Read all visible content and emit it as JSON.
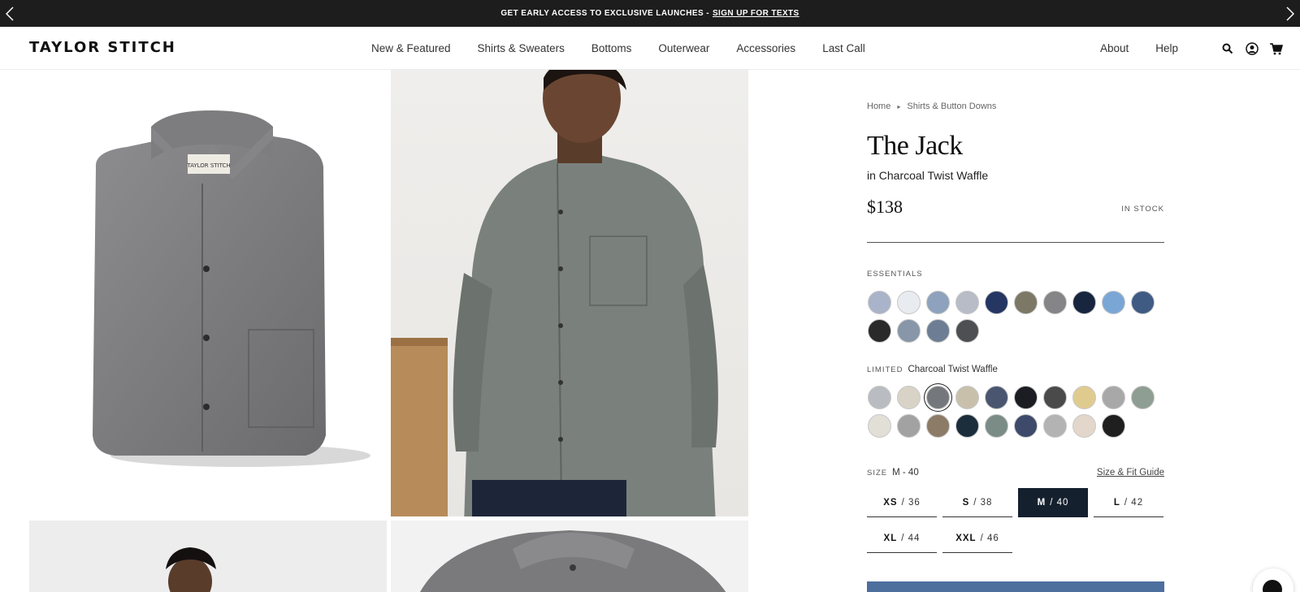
{
  "announcement": {
    "text": "GET EARLY ACCESS TO EXCLUSIVE LAUNCHES -",
    "link": "SIGN UP FOR TEXTS"
  },
  "header": {
    "logo": "TAYLOR STITCH",
    "nav": [
      "New & Featured",
      "Shirts & Sweaters",
      "Bottoms",
      "Outerwear",
      "Accessories",
      "Last Call"
    ],
    "util": [
      "About",
      "Help"
    ],
    "icons": [
      "search-icon",
      "account-icon",
      "cart-icon"
    ]
  },
  "product": {
    "breadcrumb": [
      "Home",
      "Shirts & Button Downs"
    ],
    "title": "The Jack",
    "subtitle": "in Charcoal Twist Waffle",
    "price": "$138",
    "stock": "IN STOCK",
    "essentials": {
      "label": "ESSENTIALS",
      "colors": [
        "#a9b3c9",
        "#e8ebef",
        "#8ea2bd",
        "#b7bcc6",
        "#253663",
        "#7d7866",
        "#858487",
        "#18253f",
        "#7aa6d6",
        "#3f5b83",
        "#2a2a2a",
        "#8796a8",
        "#6d7e94",
        "#4d4f52"
      ]
    },
    "limited": {
      "label": "LIMITED",
      "selected_name": "Charcoal Twist Waffle",
      "selected_index": 2,
      "colors": [
        "#b9bcc0",
        "#d9d3c7",
        "#74777b",
        "#c9c0ac",
        "#4a5670",
        "#1c1d22",
        "#4a4a4a",
        "#e0cb8f",
        "#a8a8a8",
        "#8e9e92",
        "#e2dfd6",
        "#a2a2a2",
        "#8c7b66",
        "#1c2d3c",
        "#7b8c86",
        "#3e4a6a",
        "#b3b3b3",
        "#e3d6cb",
        "#1f1f1f"
      ]
    },
    "size": {
      "label": "SIZE",
      "selected": "M - 40",
      "guide": "Size & Fit Guide",
      "options": [
        {
          "letter": "XS",
          "num": "/ 36",
          "selected": false
        },
        {
          "letter": "S",
          "num": "/ 38",
          "selected": false
        },
        {
          "letter": "M",
          "num": "/ 40",
          "selected": true
        },
        {
          "letter": "L",
          "num": "/ 42",
          "selected": false
        },
        {
          "letter": "XL",
          "num": "/ 44",
          "selected": false
        },
        {
          "letter": "XXL",
          "num": "/ 46",
          "selected": false
        }
      ]
    },
    "accent": "#4d6f9e"
  }
}
